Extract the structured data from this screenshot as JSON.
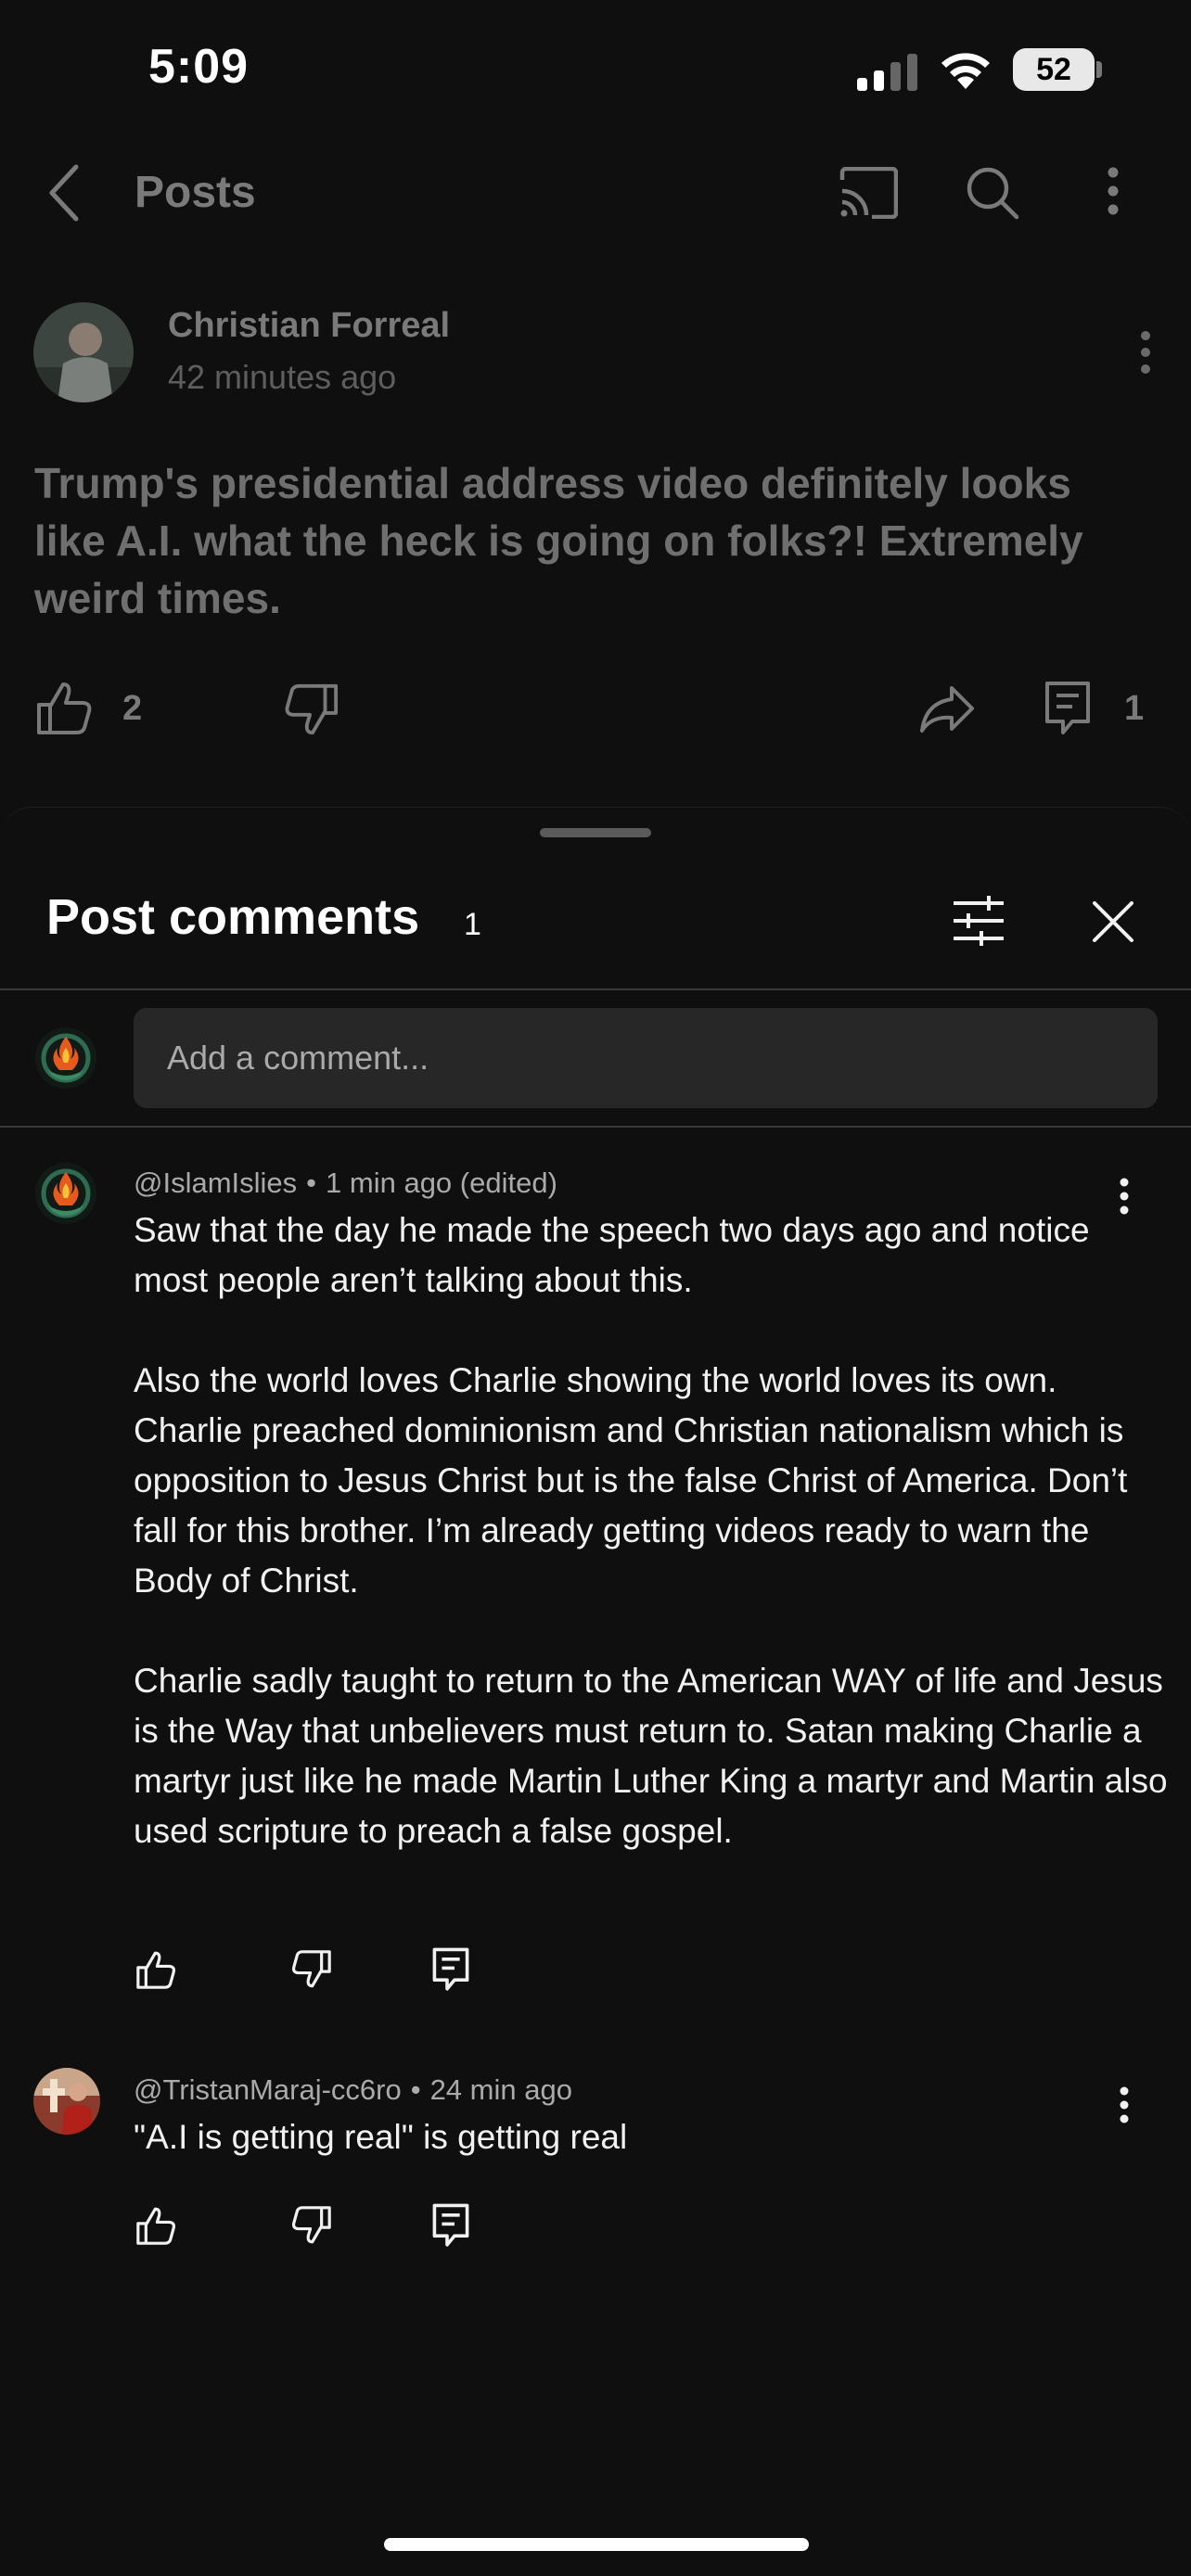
{
  "status_bar": {
    "time": "5:09",
    "battery": "52"
  },
  "topbar": {
    "title": "Posts"
  },
  "post": {
    "author": "Christian Forreal",
    "time": "42 minutes ago",
    "text": "Trump's presidential address video definitely looks like A.I. what the heck is going on folks?! Extremely weird times.",
    "likes": "2",
    "comments": "1"
  },
  "comments_sheet": {
    "title": "Post comments",
    "count": "1",
    "input_placeholder": "Add a comment...",
    "comments": [
      {
        "handle": "@IslamIslies",
        "time": "1 min ago (edited)",
        "text": "Saw that the day he made the speech two days ago and notice most people aren’t talking about this.\n\nAlso the world loves Charlie showing the world loves its own. Charlie preached dominionism and Christian nationalism which is opposition to Jesus Christ but is the false Christ of America. Don’t fall for this brother. I’m already getting videos ready to warn the Body of Christ.\n\nCharlie sadly taught to return to the American WAY of life and Jesus is the Way that unbelievers must return to. Satan making Charlie a martyr just like he made Martin Luther King a martyr and Martin also used scripture to preach a false gospel."
      },
      {
        "handle": "@TristanMaraj-cc6ro",
        "time": "24 min ago",
        "text": "\"A.I is getting real\" is getting real"
      }
    ]
  },
  "colors": {
    "background": "#0f0f0f",
    "input_bg": "#272727",
    "text_primary": "#f1f1f1",
    "text_secondary": "#aaaaaa"
  },
  "icons": [
    "back-arrow-icon",
    "cast-icon",
    "search-icon",
    "more-vert-icon",
    "thumb-up-icon",
    "thumb-down-icon",
    "share-icon",
    "comment-icon",
    "filter-icon",
    "close-icon",
    "signal-icon",
    "wifi-icon"
  ]
}
